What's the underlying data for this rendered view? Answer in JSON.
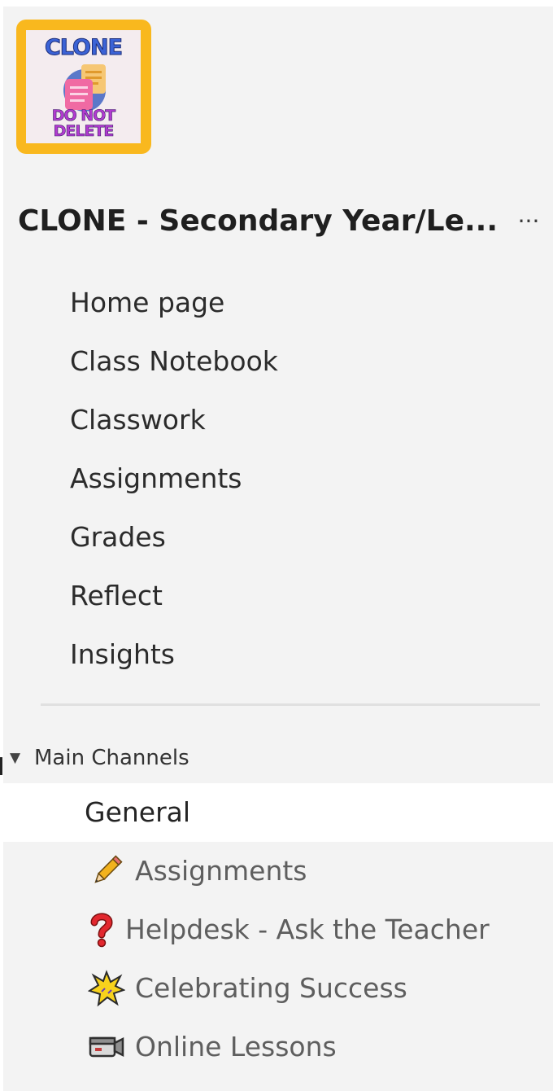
{
  "team": {
    "logo_text_top": "CLONE",
    "logo_text_bottom": "DO NOT DELETE",
    "name": "CLONE - Secondary Year/Le...",
    "more_label": "···"
  },
  "nav": {
    "items": [
      {
        "label": "Home page"
      },
      {
        "label": "Class Notebook"
      },
      {
        "label": "Classwork"
      },
      {
        "label": "Assignments"
      },
      {
        "label": "Grades"
      },
      {
        "label": "Reflect"
      },
      {
        "label": "Insights"
      }
    ]
  },
  "channels_section": {
    "title": "Main Channels",
    "items": [
      {
        "label": "General",
        "icon": null,
        "selected": true
      },
      {
        "label": "Assignments",
        "icon": "pencil-icon",
        "selected": false
      },
      {
        "label": "Helpdesk - Ask the Teacher",
        "icon": "question-mark-icon",
        "selected": false
      },
      {
        "label": "Celebrating Success",
        "icon": "star-burst-icon",
        "selected": false
      },
      {
        "label": "Online Lessons",
        "icon": "video-camera-icon",
        "selected": false
      }
    ]
  },
  "colors": {
    "background": "#f3f3f3",
    "selected_row": "#ffffff",
    "logo_frame": "#f9b81e"
  }
}
